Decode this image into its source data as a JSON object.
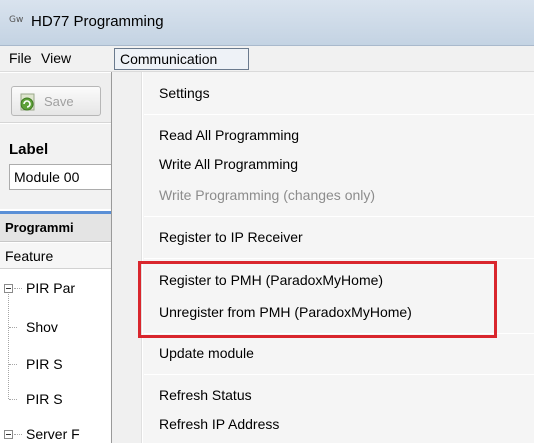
{
  "window": {
    "title": "HD77 Programming",
    "app_icon": "Gw"
  },
  "menubar": {
    "file": "File",
    "view": "View",
    "communication": "Communication"
  },
  "toolbar": {
    "save_label": "Save"
  },
  "label_panel": {
    "title": "Label",
    "module_value": "Module 00"
  },
  "programming_panel": {
    "title": "Programmi",
    "feature_header": "Feature",
    "tree": [
      "PIR Par",
      "Shov",
      "PIR S",
      "PIR S",
      "Server F"
    ]
  },
  "communication_menu": {
    "items": [
      "Settings",
      "Read All Programming",
      "Write All Programming",
      "Write Programming (changes only)",
      "Register to IP Receiver",
      "Register to PMH (ParadoxMyHome)",
      "Unregister from PMH (ParadoxMyHome)",
      "Update module",
      "Refresh Status",
      "Refresh IP Address"
    ]
  },
  "colors": {
    "highlight": "#d9262d",
    "accent_line": "#5a8fd6"
  }
}
